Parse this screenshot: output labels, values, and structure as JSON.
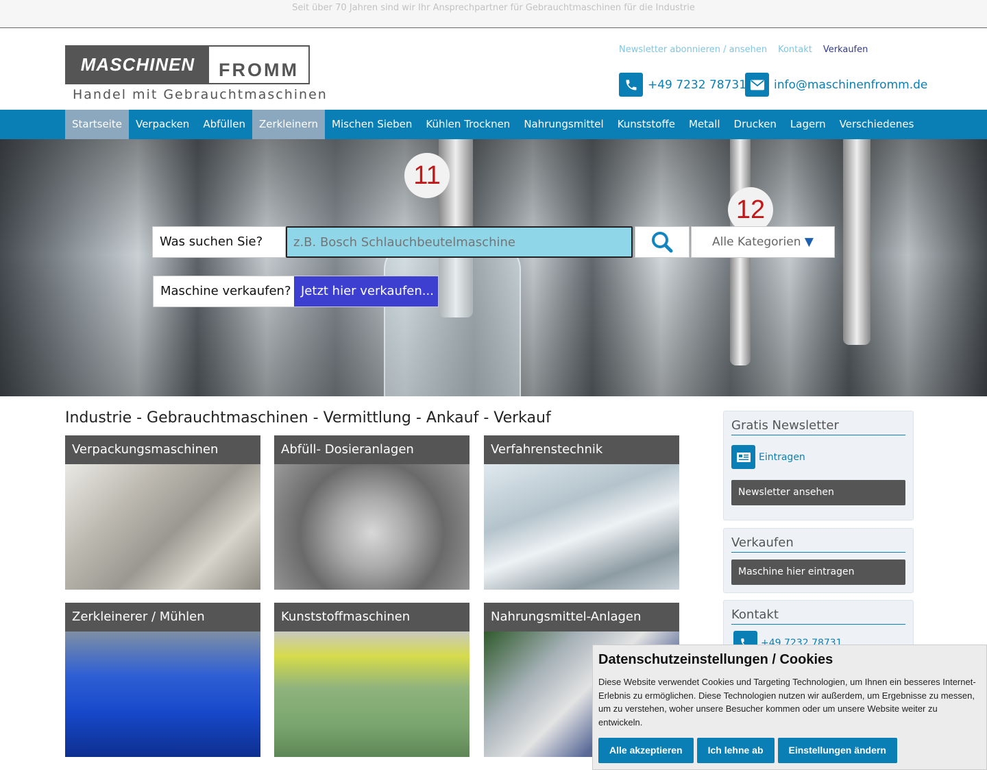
{
  "topbar": {
    "text": "Seit über 70 Jahren sind wir Ihr Ansprechpartner für Gebrauchtmaschinen für die Industrie"
  },
  "logo": {
    "left": "MASCHINEN",
    "right": "FROMM",
    "tagline": "Handel mit Gebrauchtmaschinen"
  },
  "header_links": [
    "Newsletter abonnieren / ansehen",
    "Kontakt",
    "Verkaufen"
  ],
  "contact": {
    "phone": "+49 7232 78731",
    "email": "info@maschinenfromm.de",
    "phone_icon": "phone-icon",
    "email_icon": "envelope-icon"
  },
  "nav": [
    "Startseite",
    "Verpacken",
    "Abfüllen",
    "Zerkleinern",
    "Mischen Sieben",
    "Kühlen Trocknen",
    "Nahrungsmittel",
    "Kunststoffe",
    "Metall",
    "Drucken",
    "Lagern",
    "Verschiedenes"
  ],
  "hero": {
    "numbers": [
      "11",
      "12"
    ]
  },
  "search": {
    "label": "Was suchen Sie?",
    "placeholder": "z.B. Bosch Schlauchbeutelmaschine",
    "category": "Alle Kategorien",
    "category_arrow": "▼",
    "icon": "search-icon"
  },
  "sell": {
    "label": "Maschine verkaufen?",
    "button": "Jetzt hier verkaufen..."
  },
  "main": {
    "title": "Industrie - Gebrauchtmaschinen - Vermittlung - Ankauf - Verkauf",
    "tiles": [
      "Verpackungsmaschinen",
      "Abfüll- Dosieranlagen",
      "Verfahrenstechnik",
      "Zerkleinerer / Mühlen",
      "Kunststoffmaschinen",
      "Nahrungsmittel-Anlagen"
    ]
  },
  "sidebar": {
    "newsletter": {
      "title": "Gratis Newsletter",
      "subscribe": "Eintragen",
      "view": "Newsletter ansehen",
      "icon": "newsletter-icon"
    },
    "sell": {
      "title": "Verkaufen",
      "button": "Maschine hier eintragen"
    },
    "contact": {
      "title": "Kontakt",
      "phone": "+49 7232 78731"
    }
  },
  "cookie": {
    "title": "Datenschutzeinstellungen / Cookies",
    "text": "Diese Website verwendet Cookies und Targeting Technologien, um Ihnen ein besseres Internet-Erlebnis zu ermöglichen. Diese Technologien nutzen wir außerdem, um Ergebnisse zu messen, um zu verstehen, woher unsere Besucher kommen oder um unsere Website weiter zu entwickeln.",
    "accept": "Alle akzeptieren",
    "decline": "Ich lehne ab",
    "settings": "Einstellungen ändern"
  },
  "colors": {
    "primary": "#0a7fb5",
    "nav_active": "#8ba8be",
    "sell_button": "#3c3fcf",
    "search_field": "#8fd6e8",
    "tile_header": "#555555"
  }
}
